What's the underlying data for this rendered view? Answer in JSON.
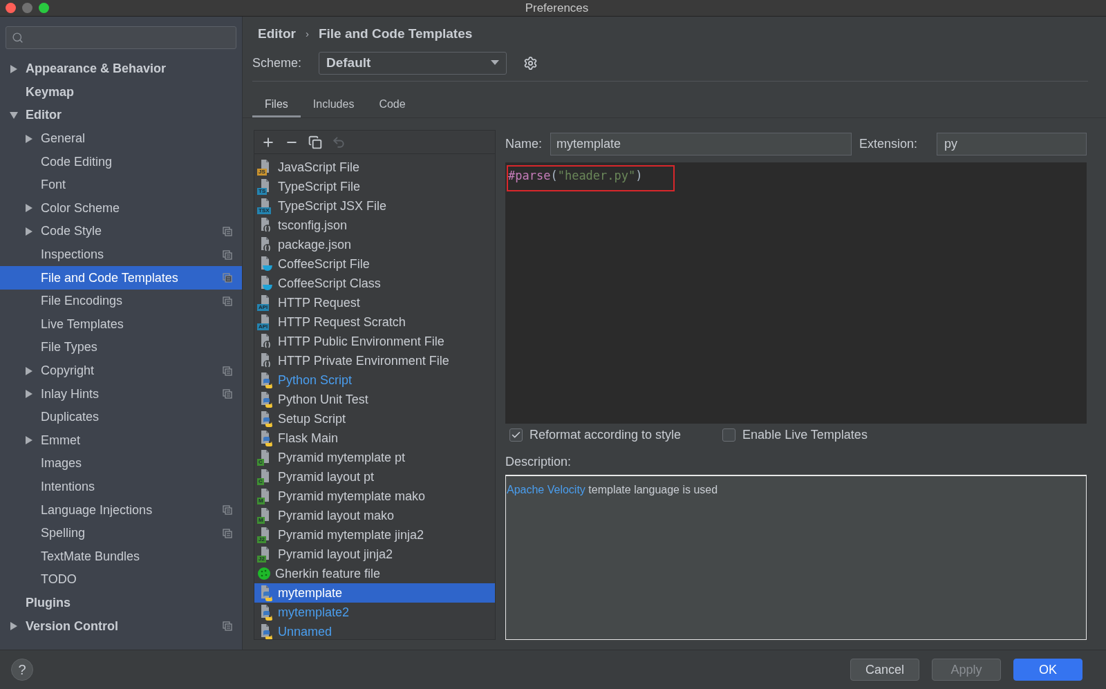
{
  "window": {
    "title": "Preferences"
  },
  "sidebar": {
    "items": [
      {
        "label": "Appearance & Behavior",
        "expanded": false,
        "project_scope": false,
        "selected": false
      },
      {
        "label": "Keymap",
        "project_scope": false,
        "selected": false
      },
      {
        "label": "Editor",
        "expanded": true,
        "project_scope": false,
        "selected": false,
        "children": [
          {
            "label": "General",
            "expanded": false,
            "project_scope": false,
            "selected": false
          },
          {
            "label": "Code Editing",
            "project_scope": false,
            "selected": false
          },
          {
            "label": "Font",
            "project_scope": false,
            "selected": false
          },
          {
            "label": "Color Scheme",
            "expanded": false,
            "project_scope": false,
            "selected": false
          },
          {
            "label": "Code Style",
            "expanded": false,
            "project_scope": true,
            "selected": false
          },
          {
            "label": "Inspections",
            "project_scope": true,
            "selected": false
          },
          {
            "label": "File and Code Templates",
            "project_scope": true,
            "selected": true
          },
          {
            "label": "File Encodings",
            "project_scope": true,
            "selected": false
          },
          {
            "label": "Live Templates",
            "project_scope": false,
            "selected": false
          },
          {
            "label": "File Types",
            "project_scope": false,
            "selected": false
          },
          {
            "label": "Copyright",
            "expanded": false,
            "project_scope": true,
            "selected": false
          },
          {
            "label": "Inlay Hints",
            "expanded": false,
            "project_scope": true,
            "selected": false
          },
          {
            "label": "Duplicates",
            "project_scope": false,
            "selected": false
          },
          {
            "label": "Emmet",
            "expanded": false,
            "project_scope": false,
            "selected": false
          },
          {
            "label": "Images",
            "project_scope": false,
            "selected": false
          },
          {
            "label": "Intentions",
            "project_scope": false,
            "selected": false
          },
          {
            "label": "Language Injections",
            "project_scope": true,
            "selected": false
          },
          {
            "label": "Spelling",
            "project_scope": true,
            "selected": false
          },
          {
            "label": "TextMate Bundles",
            "project_scope": false,
            "selected": false
          },
          {
            "label": "TODO",
            "project_scope": false,
            "selected": false
          }
        ]
      },
      {
        "label": "Plugins",
        "project_scope": false,
        "selected": false
      },
      {
        "label": "Version Control",
        "expanded": false,
        "project_scope": true,
        "selected": false
      }
    ]
  },
  "breadcrumb": {
    "items": [
      "Editor",
      "File and Code Templates"
    ],
    "separator": "›"
  },
  "scheme": {
    "label": "Scheme:",
    "value": "Default"
  },
  "tabs": [
    {
      "label": "Files",
      "selected": true
    },
    {
      "label": "Includes",
      "selected": false
    },
    {
      "label": "Code",
      "selected": false
    }
  ],
  "templates": {
    "toolbar": [
      {
        "kind": "add",
        "disabled": false
      },
      {
        "kind": "remove",
        "disabled": false
      },
      {
        "kind": "copy",
        "disabled": false
      },
      {
        "kind": "reset",
        "disabled": true
      }
    ],
    "items": [
      {
        "label": "JavaScript File",
        "kind": "js",
        "badge": "JS",
        "modified": false,
        "selected": false
      },
      {
        "label": "TypeScript File",
        "kind": "ts",
        "badge": "TS",
        "modified": false,
        "selected": false
      },
      {
        "label": "TypeScript JSX File",
        "kind": "ts",
        "badge": "TSX",
        "modified": false,
        "selected": false
      },
      {
        "label": "tsconfig.json",
        "kind": "json",
        "modified": false,
        "selected": false
      },
      {
        "label": "package.json",
        "kind": "json",
        "modified": false,
        "selected": false
      },
      {
        "label": "CoffeeScript File",
        "kind": "coffee",
        "modified": false,
        "selected": false
      },
      {
        "label": "CoffeeScript Class",
        "kind": "coffee",
        "modified": false,
        "selected": false
      },
      {
        "label": "HTTP Request",
        "kind": "ts",
        "badge": "API",
        "modified": false,
        "selected": false
      },
      {
        "label": "HTTP Request Scratch",
        "kind": "ts",
        "badge": "API",
        "modified": false,
        "selected": false
      },
      {
        "label": "HTTP Public Environment File",
        "kind": "json",
        "modified": false,
        "selected": false
      },
      {
        "label": "HTTP Private Environment File",
        "kind": "json",
        "modified": false,
        "selected": false
      },
      {
        "label": "Python Script",
        "kind": "python",
        "modified": true,
        "selected": false
      },
      {
        "label": "Python Unit Test",
        "kind": "python",
        "modified": false,
        "selected": false
      },
      {
        "label": "Setup Script",
        "kind": "python",
        "modified": false,
        "selected": false
      },
      {
        "label": "Flask Main",
        "kind": "python",
        "modified": false,
        "selected": false
      },
      {
        "label": "Pyramid mytemplate pt",
        "kind": "pyramid",
        "badge": "C",
        "modified": false,
        "selected": false
      },
      {
        "label": "Pyramid layout pt",
        "kind": "pyramid",
        "badge": "C",
        "modified": false,
        "selected": false
      },
      {
        "label": "Pyramid mytemplate mako",
        "kind": "pyramid",
        "badge": "M",
        "modified": false,
        "selected": false
      },
      {
        "label": "Pyramid layout mako",
        "kind": "pyramid",
        "badge": "M",
        "modified": false,
        "selected": false
      },
      {
        "label": "Pyramid mytemplate jinja2",
        "kind": "pyramid",
        "badge": "J2",
        "modified": false,
        "selected": false
      },
      {
        "label": "Pyramid layout jinja2",
        "kind": "pyramid",
        "badge": "J2",
        "modified": false,
        "selected": false
      },
      {
        "label": "Gherkin feature file",
        "kind": "gherkin",
        "modified": false,
        "selected": false
      },
      {
        "label": "mytemplate",
        "kind": "python",
        "selected": true
      },
      {
        "label": "mytemplate2",
        "kind": "python",
        "modified": true,
        "selected": false
      },
      {
        "label": "Unnamed",
        "kind": "python",
        "modified": true,
        "selected": false
      }
    ]
  },
  "editor": {
    "name_label": "Name:",
    "name": "mytemplate",
    "extension_label": "Extension:",
    "extension": "py",
    "highlighted": true,
    "code": [
      {
        "text": "#parse",
        "kind": "directive"
      },
      {
        "text": "(",
        "kind": "punct"
      },
      {
        "text": "\"header.py\"",
        "kind": "string"
      },
      {
        "text": ")",
        "kind": "punct"
      }
    ]
  },
  "options": [
    {
      "label": "Reformat according to style",
      "checked": true
    },
    {
      "label": "Enable Live Templates",
      "checked": false
    }
  ],
  "description": {
    "label": "Description:",
    "link": "Apache Velocity",
    "text": "template language is used"
  },
  "help": {
    "label": "?"
  },
  "buttons": [
    {
      "label": "Cancel",
      "kind": "default",
      "disabled": false
    },
    {
      "label": "Apply",
      "kind": "default",
      "disabled": true
    },
    {
      "label": "OK",
      "kind": "primary",
      "disabled": false
    }
  ]
}
